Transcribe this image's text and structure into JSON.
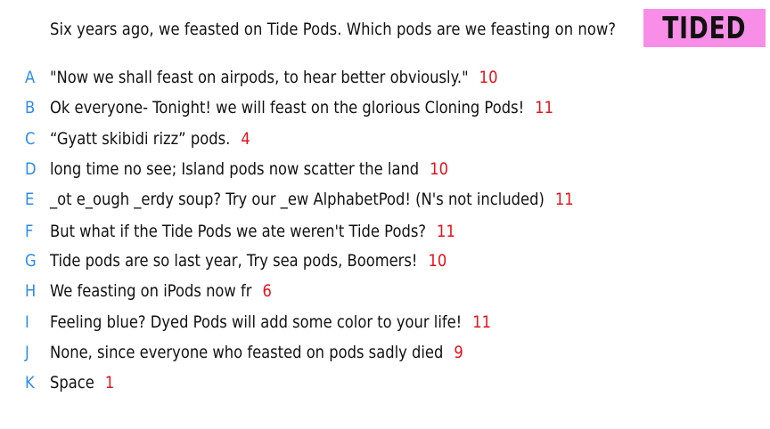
{
  "question": "Six years ago, we feasted on Tide Pods. Which pods are we feasting on now?",
  "badge": {
    "text": "TIDED",
    "color": "#f98ee8"
  },
  "colors": {
    "letter": "#2e8de6",
    "count": "#e0141e",
    "text": "#111111"
  },
  "options": [
    {
      "letter": "A",
      "text": "\"Now we shall feast on airpods, to hear better obviously.\"",
      "count": "10"
    },
    {
      "letter": "B",
      "text": "Ok everyone- Tonight! we will feast on the glorious Cloning Pods!",
      "count": "11"
    },
    {
      "letter": "C",
      "text": "“Gyatt skibidi rizz” pods.",
      "count": "4"
    },
    {
      "letter": "D",
      "text": "long time no see; Island pods now scatter the land",
      "count": "10"
    },
    {
      "letter": "E",
      "text": "_ot e_ough _erdy soup? Try our _ew AlphabetPod! (N's not included)",
      "count": "11"
    },
    {
      "letter": "F",
      "text": "But what if the Tide Pods we ate weren't Tide Pods?",
      "count": "11"
    },
    {
      "letter": "G",
      "text": "Tide pods are so last year, Try sea pods, Boomers!",
      "count": "10"
    },
    {
      "letter": "H",
      "text": "We feasting on iPods now fr",
      "count": "6"
    },
    {
      "letter": "I",
      "text": "Feeling blue? Dyed Pods will add some color to your life!",
      "count": "11"
    },
    {
      "letter": "J",
      "text": "None, since everyone who feasted on pods sadly died",
      "count": "9"
    },
    {
      "letter": "K",
      "text": "Space",
      "count": "1"
    }
  ]
}
